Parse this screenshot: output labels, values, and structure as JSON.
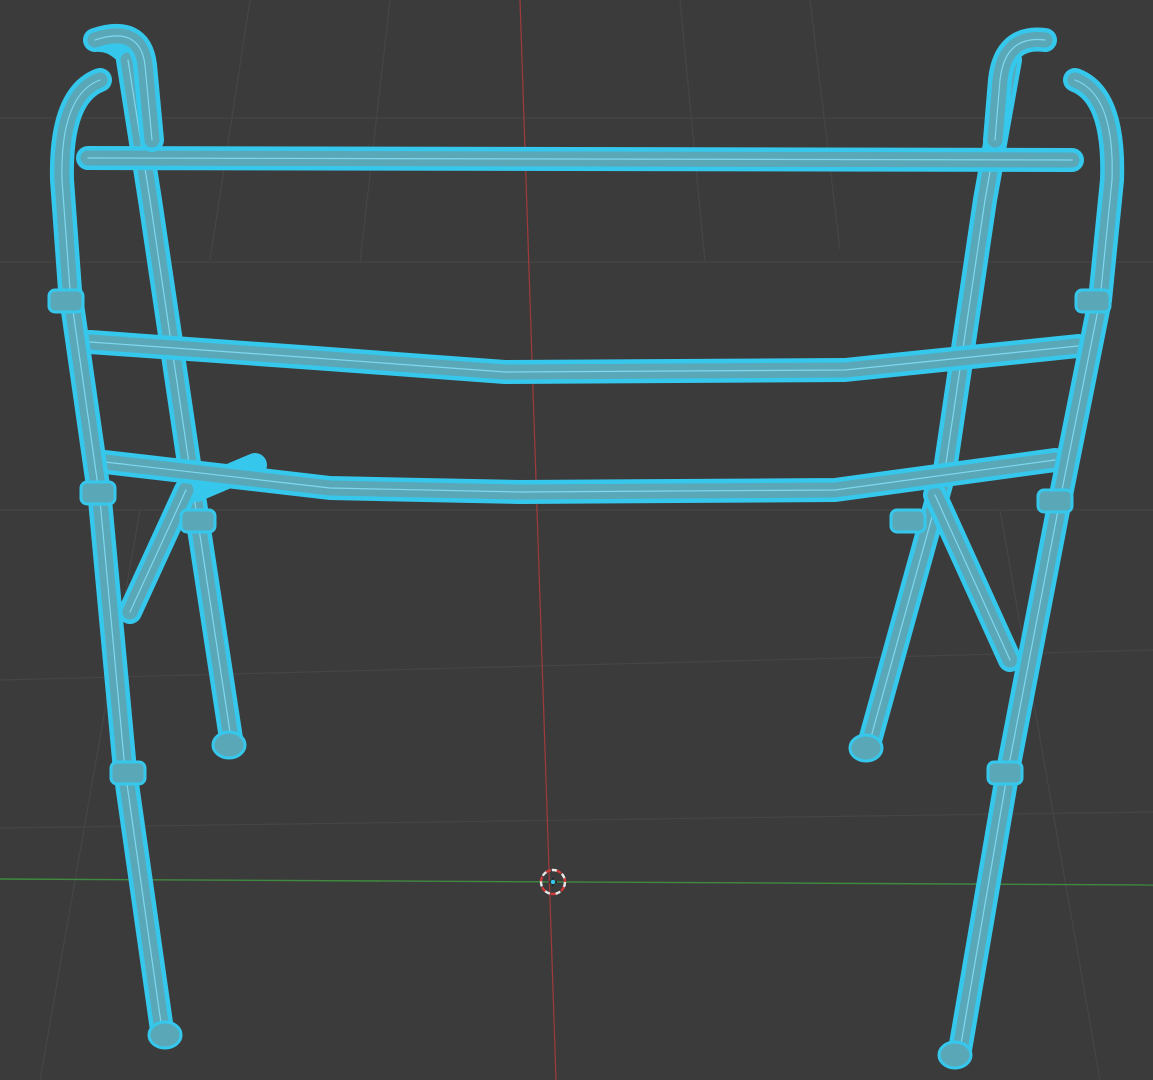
{
  "viewport": {
    "background_color": "#3b3b3b",
    "grid_color": "#454545"
  },
  "axes": {
    "x_axis_color": "#3f8a3f",
    "y_axis_color": "#a13b3b"
  },
  "object": {
    "wire_color": "#36c8ec",
    "shade_color": "#5aa7b8",
    "mesh_color": "#7fd8ef"
  },
  "cursor": {
    "icon": "3d-cursor-icon",
    "ring_color_a": "#e8e8e8",
    "ring_color_b": "#d23a3a"
  }
}
